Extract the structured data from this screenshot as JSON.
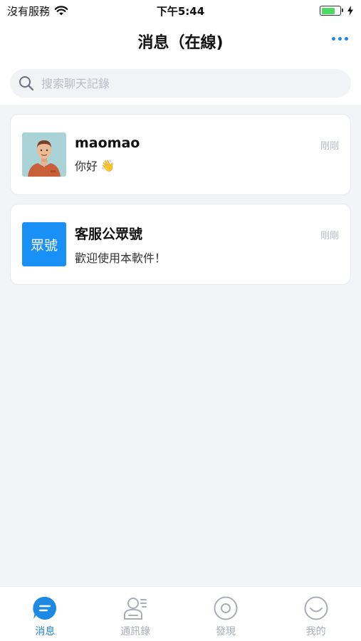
{
  "status_bar": {
    "carrier": "沒有服務",
    "time": "下午5:44",
    "battery_level": 0.75
  },
  "header": {
    "title": "消息（在線)"
  },
  "search": {
    "placeholder": "搜索聊天記錄"
  },
  "conversations": [
    {
      "name": "maomao",
      "message": "你好",
      "emoji": "👋",
      "time": "剛剛",
      "avatar": "person-avatar"
    },
    {
      "name": "客服公眾號",
      "message": "歡迎使用本軟件！",
      "time": "剛剛",
      "avatar_text": "眾號"
    }
  ],
  "tabs": [
    {
      "label": "消息",
      "icon": "chat-bubble-icon",
      "active": true
    },
    {
      "label": "通訊錄",
      "icon": "contacts-icon",
      "active": false
    },
    {
      "label": "發現",
      "icon": "discover-icon",
      "active": false
    },
    {
      "label": "我的",
      "icon": "smile-icon",
      "active": false
    }
  ],
  "colors": {
    "accent": "#1e88e5",
    "background": "#f3f4f8",
    "inactive": "#a8adb8",
    "avatar_blue": "#1990f5"
  }
}
